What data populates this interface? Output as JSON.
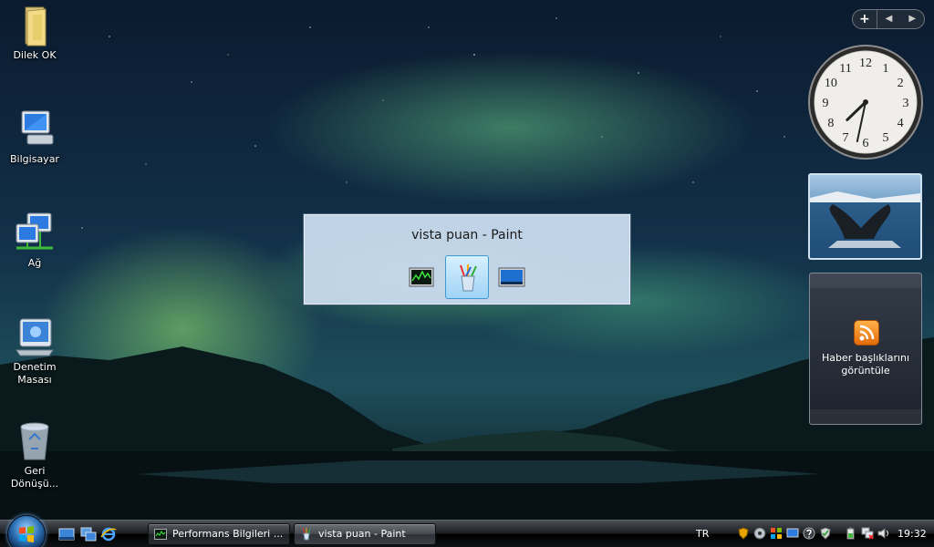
{
  "desktop": {
    "icons": [
      {
        "label": "Dilek OK",
        "icon": "folder-icon"
      },
      {
        "label": "Bilgisayar",
        "icon": "computer-icon"
      },
      {
        "label": "Ağ",
        "icon": "network-icon"
      },
      {
        "label": "Denetim Masası",
        "icon": "control-panel-icon"
      },
      {
        "label": "Geri Dönüşü...",
        "icon": "recycle-bin-icon"
      }
    ]
  },
  "sidebar": {
    "add_label": "+",
    "prev_label": "◀",
    "next_label": "▶",
    "clock": {
      "time": "19:32",
      "hour": 7,
      "minute": 32,
      "numbers": [
        "12",
        "1",
        "2",
        "3",
        "4",
        "5",
        "6",
        "7",
        "8",
        "9",
        "10",
        "11"
      ]
    },
    "feed": {
      "label": "Haber başlıklarını görüntüle"
    }
  },
  "switcher": {
    "title": "vista puan - Paint",
    "items": [
      {
        "name": "performance-window-thumb"
      },
      {
        "name": "paint-window-thumb",
        "selected": true
      },
      {
        "name": "desktop-thumb"
      }
    ]
  },
  "taskbar": {
    "tasks": [
      {
        "label": "Performans Bilgileri ..."
      },
      {
        "label": "vista puan - Paint"
      }
    ],
    "language": "TR",
    "time": "19:32"
  }
}
